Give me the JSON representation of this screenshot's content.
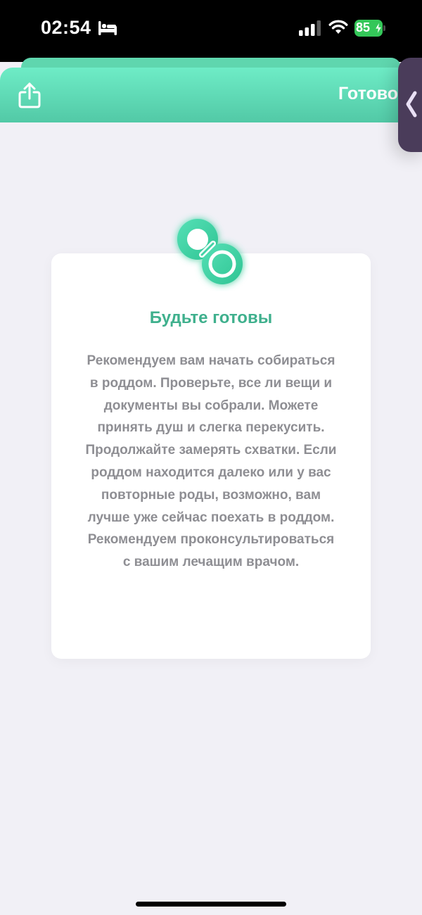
{
  "status_bar": {
    "time": "02:54",
    "battery_level": "85",
    "icons": [
      "bed-icon",
      "cellular-signal-icon",
      "wifi-icon",
      "battery-charging-icon"
    ]
  },
  "header": {
    "title": "Готово",
    "share_icon": "share-icon",
    "side_tab_icon": "chevron-left-icon"
  },
  "card": {
    "icon": "pacifier-icon",
    "title": "Будьте готовы",
    "text": "Рекомендуем вам начать собираться в роддом. Проверьте, все ли вещи и документы вы собрали. Можете принять душ и слегка перекусить. Продолжайте замерять схватки. Если роддом находится далеко или у вас повторные роды, возможно, вам лучше уже сейчас поехать в роддом. Рекомендуем проконсультироваться с вашим лечащим врачом."
  },
  "colors": {
    "accent": "#3fb08d",
    "header_gradient_top": "#6eecc6",
    "header_gradient_bottom": "#52c9a6",
    "background": "#f1f0f6",
    "body_text": "#8e8e93",
    "side_tab": "#4a3c5a"
  }
}
